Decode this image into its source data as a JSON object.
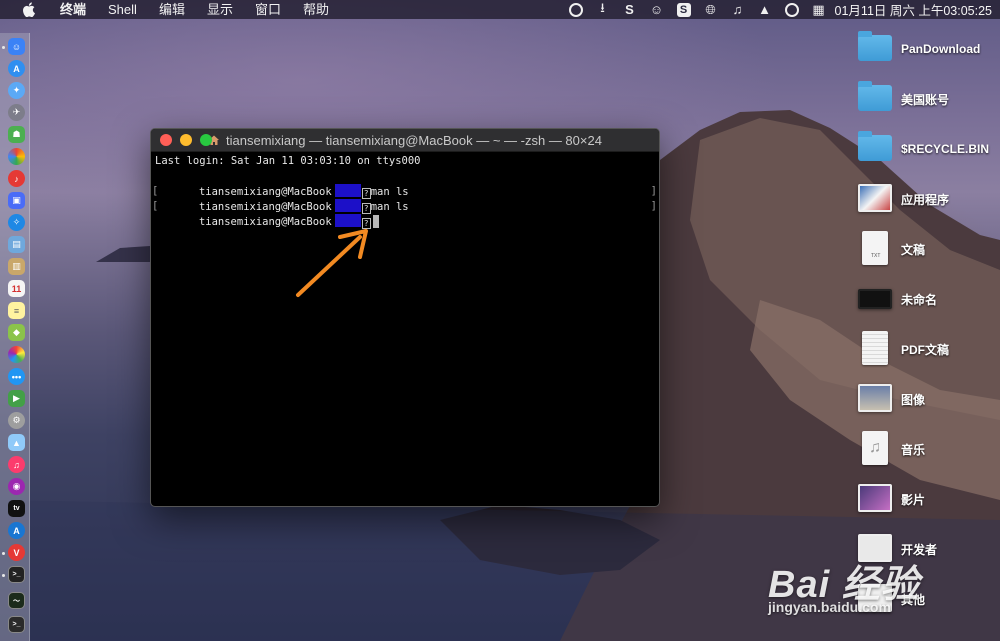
{
  "menubar": {
    "app_name": "终端",
    "items": [
      "Shell",
      "编辑",
      "显示",
      "窗口",
      "帮助"
    ],
    "clock": "01月11日 周六 上午03:05:25"
  },
  "terminal": {
    "title": "tiansemixiang — tiansemixiang@MacBook — ~ — -zsh — 80×24",
    "last_login": "Last login: Sat Jan 11 03:03:10 on ttys000",
    "prompt_host": "tiansemixiang@MacBook",
    "lines": [
      {
        "command": "man ls"
      },
      {
        "command": "man ls"
      },
      {
        "command": ""
      }
    ],
    "qmark": "?"
  },
  "desktop": {
    "items": [
      {
        "label": "PanDownload",
        "icon": "folder-icon"
      },
      {
        "label": "美国账号",
        "icon": "folder-icon"
      },
      {
        "label": "$RECYCLE.BIN",
        "icon": "folder-icon"
      },
      {
        "label": "应用程序",
        "icon": "screenshot-thumbnail-icon"
      },
      {
        "label": "文稿",
        "icon": "text-document-icon"
      },
      {
        "label": "未命名",
        "icon": "screenshot-thumbnail-icon"
      },
      {
        "label": "PDF文稿",
        "icon": "pdf-document-icon"
      },
      {
        "label": "图像",
        "icon": "image-thumbnail-icon"
      },
      {
        "label": "音乐",
        "icon": "music-document-icon"
      },
      {
        "label": "影片",
        "icon": "movie-thumbnail-icon"
      },
      {
        "label": "开发者",
        "icon": "screenshot-thumbnail-icon"
      },
      {
        "label": "其他",
        "icon": "screenshot-thumbnail-icon"
      }
    ],
    "doc_tag": "TXT"
  },
  "watermark": {
    "brand": "Bai 经验",
    "url": "jingyan.baidu.com"
  },
  "colors": {
    "annotation_arrow": "#f28a22",
    "terminal_highlight": "#1c10c8"
  }
}
